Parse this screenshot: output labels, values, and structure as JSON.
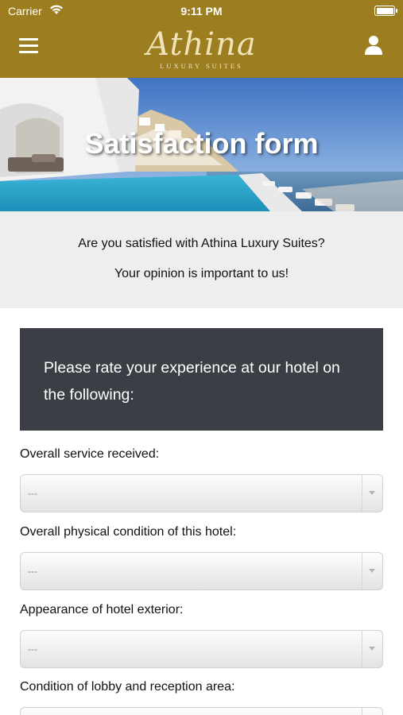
{
  "status_bar": {
    "carrier": "Carrier",
    "time": "9:11 PM"
  },
  "header": {
    "logo_script": "Athina",
    "logo_sub": "LUXURY SUITES",
    "brand_color": "#9c7d1f",
    "menu_icon": "hamburger-menu-icon",
    "user_icon": "user-icon"
  },
  "hero": {
    "title": "Satisfaction form"
  },
  "intro": {
    "line1": "Are you satisfied with Athina Luxury Suites?",
    "line2": "Your opinion is important to us!"
  },
  "panel": {
    "text": "Please rate your experience at our hotel on the following:",
    "color": "#3b3f45"
  },
  "questions": [
    {
      "label": "Overall service received:",
      "value": "---"
    },
    {
      "label": "Overall physical condition of this hotel:",
      "value": "---"
    },
    {
      "label": "Appearance of hotel exterior:",
      "value": "---"
    },
    {
      "label": "Condition of lobby and reception area:",
      "value": "---"
    }
  ]
}
